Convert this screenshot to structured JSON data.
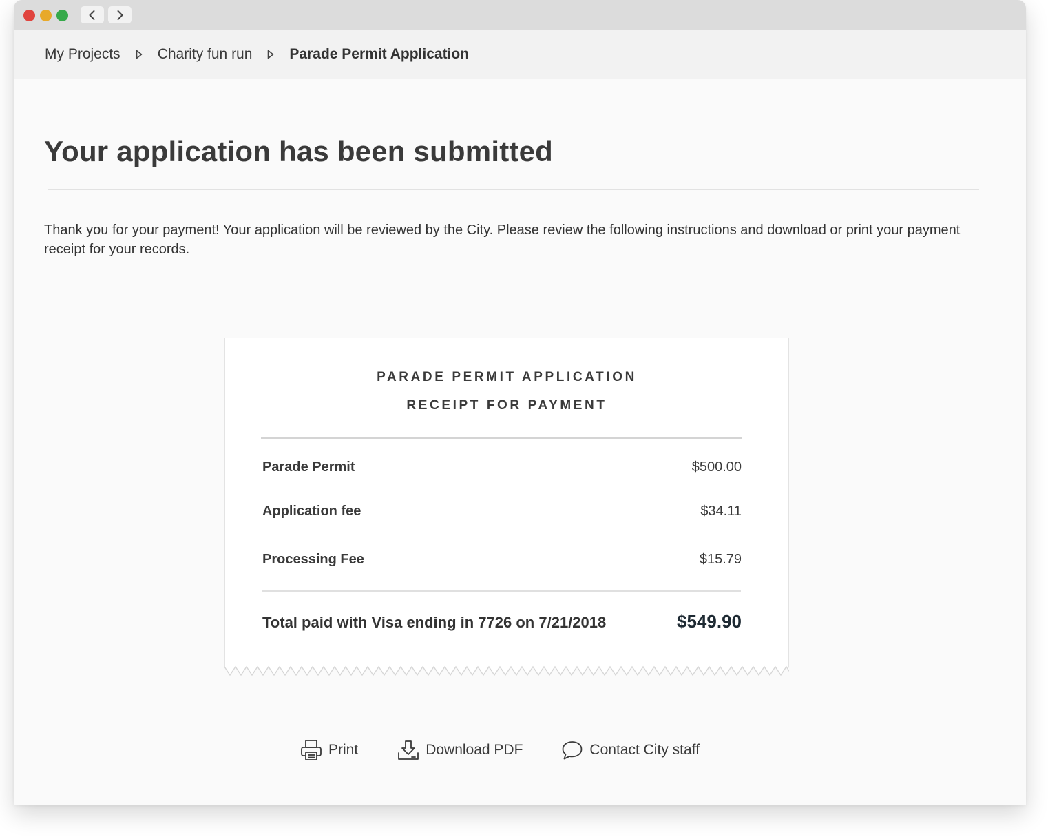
{
  "breadcrumb": {
    "items": [
      {
        "label": "My Projects"
      },
      {
        "label": "Charity fun run"
      },
      {
        "label": "Parade Permit Application"
      }
    ]
  },
  "page": {
    "title": "Your application has been submitted",
    "intro": "Thank you for your payment! Your application will be reviewed by the City. Please review the following instructions and download or print your payment receipt for your records."
  },
  "receipt": {
    "heading1": "PARADE PERMIT APPLICATION",
    "heading2": "RECEIPT FOR PAYMENT",
    "items": [
      {
        "label": "Parade Permit",
        "amount": "$500.00"
      },
      {
        "label": "Application fee",
        "amount": "$34.11"
      },
      {
        "label": "Processing Fee",
        "amount": "$15.79"
      }
    ],
    "total_label": "Total paid with Visa ending in 7726 on 7/21/2018",
    "total_amount": "$549.90"
  },
  "actions": {
    "print_label": "Print",
    "download_label": "Download PDF",
    "contact_label": "Contact City staff"
  },
  "icons": {
    "back": "chevron-left-icon",
    "forward": "chevron-right-icon",
    "breadcrumb_separator": "triangle-right-icon",
    "print": "printer-icon",
    "download": "download-icon",
    "contact": "chat-bubble-icon"
  },
  "colors": {
    "close": "#e0443e",
    "minimize": "#e8a92a",
    "zoom": "#36a94a",
    "total_amount": "#1e2a33"
  }
}
